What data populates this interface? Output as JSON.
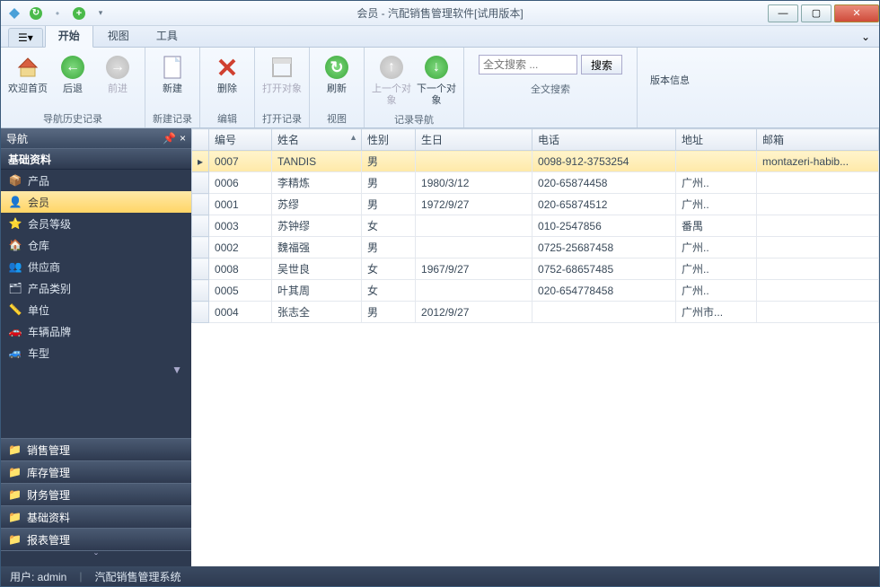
{
  "window": {
    "title": "会员 - 汽配销售管理软件[试用版本]"
  },
  "ribbon_tabs": {
    "start": "开始",
    "view": "视图",
    "tools": "工具"
  },
  "ribbon": {
    "welcome": "欢迎首页",
    "back": "后退",
    "forward": "前进",
    "new": "新建",
    "delete": "删除",
    "open_object": "打开对象",
    "refresh": "刷新",
    "prev_object": "上一个对象",
    "next_object": "下一个对象",
    "search_btn": "搜索",
    "search_placeholder": "全文搜索 ...",
    "version_info": "版本信息",
    "grp_history": "导航历史记录",
    "grp_newrec": "新建记录",
    "grp_edit": "编辑",
    "grp_openrec": "打开记录",
    "grp_view": "视图",
    "grp_recordnav": "记录导航",
    "grp_fullsearch": "全文搜索"
  },
  "nav": {
    "title": "导航",
    "cat_basic": "基础资料",
    "items": {
      "product": "产品",
      "member": "会员",
      "member_level": "会员等级",
      "warehouse": "仓库",
      "supplier": "供应商",
      "product_category": "产品类别",
      "unit": "单位",
      "vehicle_brand": "车辆品牌",
      "vehicle_model": "车型"
    },
    "sections": {
      "sales": "销售管理",
      "inventory": "库存管理",
      "finance": "财务管理",
      "basic": "基础资料",
      "report": "报表管理"
    }
  },
  "grid": {
    "cols": {
      "id": "编号",
      "name": "姓名",
      "gender": "性别",
      "birthday": "生日",
      "phone": "电话",
      "address": "地址",
      "email": "邮箱"
    },
    "rows": [
      {
        "id": "0007",
        "name": "TANDIS",
        "gender": "男",
        "birthday": "",
        "phone": "0098-912-3753254",
        "address": "",
        "email": "montazeri-habib..."
      },
      {
        "id": "0006",
        "name": "李精炼",
        "gender": "男",
        "birthday": "1980/3/12",
        "phone": "020-65874458",
        "address": "广州..",
        "email": ""
      },
      {
        "id": "0001",
        "name": "苏缪",
        "gender": "男",
        "birthday": "1972/9/27",
        "phone": "020-65874512",
        "address": "广州..",
        "email": ""
      },
      {
        "id": "0003",
        "name": "苏钟缪",
        "gender": "女",
        "birthday": "",
        "phone": "010-2547856",
        "address": "番禺",
        "email": ""
      },
      {
        "id": "0002",
        "name": "魏福强",
        "gender": "男",
        "birthday": "",
        "phone": "0725-25687458",
        "address": "广州..",
        "email": ""
      },
      {
        "id": "0008",
        "name": "吴世良",
        "gender": "女",
        "birthday": "1967/9/27",
        "phone": "0752-68657485",
        "address": "广州..",
        "email": ""
      },
      {
        "id": "0005",
        "name": "叶其周",
        "gender": "女",
        "birthday": "",
        "phone": "020-654778458",
        "address": "广州..",
        "email": ""
      },
      {
        "id": "0004",
        "name": "张志全",
        "gender": "男",
        "birthday": "2012/9/27",
        "phone": "",
        "address": "广州市...",
        "email": ""
      }
    ]
  },
  "status": {
    "user_label": "用户: admin",
    "system": "汽配销售管理系统"
  }
}
